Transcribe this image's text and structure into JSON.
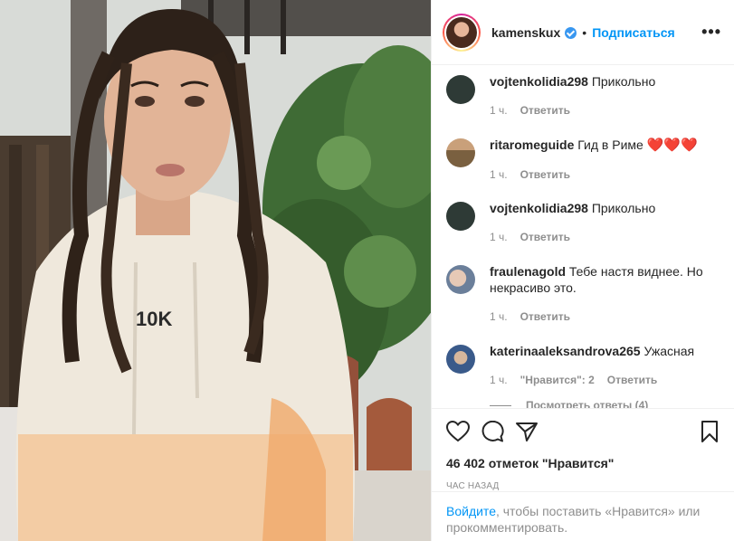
{
  "post": {
    "username": "kamenskux",
    "follow_label": "Подписаться",
    "dot": "•",
    "more_label": "•••",
    "sweatshirt_text": "10K"
  },
  "comments": [
    {
      "user": "vojtenkolidia298",
      "text": "Прикольно",
      "time": "1 ч.",
      "reply": "Ответить",
      "avatar_color": "#2e3a36"
    },
    {
      "user": "ritaromeguide",
      "text": "Гид в Риме",
      "hearts": "❤️❤️❤️",
      "time": "1 ч.",
      "reply": "Ответить",
      "avatar_color": "#b88a5a"
    },
    {
      "user": "vojtenkolidia298",
      "text": "Прикольно",
      "time": "1 ч.",
      "reply": "Ответить",
      "avatar_color": "#2e3a36"
    },
    {
      "user": "fraulenagold",
      "text": "Тебе настя виднее. Но некрасиво это.",
      "time": "1 ч.",
      "reply": "Ответить",
      "avatar_color": "#c7a99a"
    },
    {
      "user": "katerinaaleksandrova265",
      "text": "Ужасная",
      "time": "1 ч.",
      "likes": "\"Нравится\": 2",
      "reply": "Ответить",
      "avatar_color": "#3a5a8a"
    }
  ],
  "view_replies": "Посмотреть ответы (4)",
  "likes_count": "46 402 отметок \"Нравится\"",
  "time_ago": "ЧАС НАЗАД",
  "login": {
    "link": "Войдите",
    "text": ", чтобы поставить «Нравится» или прокомментировать."
  },
  "icons": {
    "like": "heart-icon",
    "comment": "comment-icon",
    "share": "share-icon",
    "save": "bookmark-icon"
  }
}
